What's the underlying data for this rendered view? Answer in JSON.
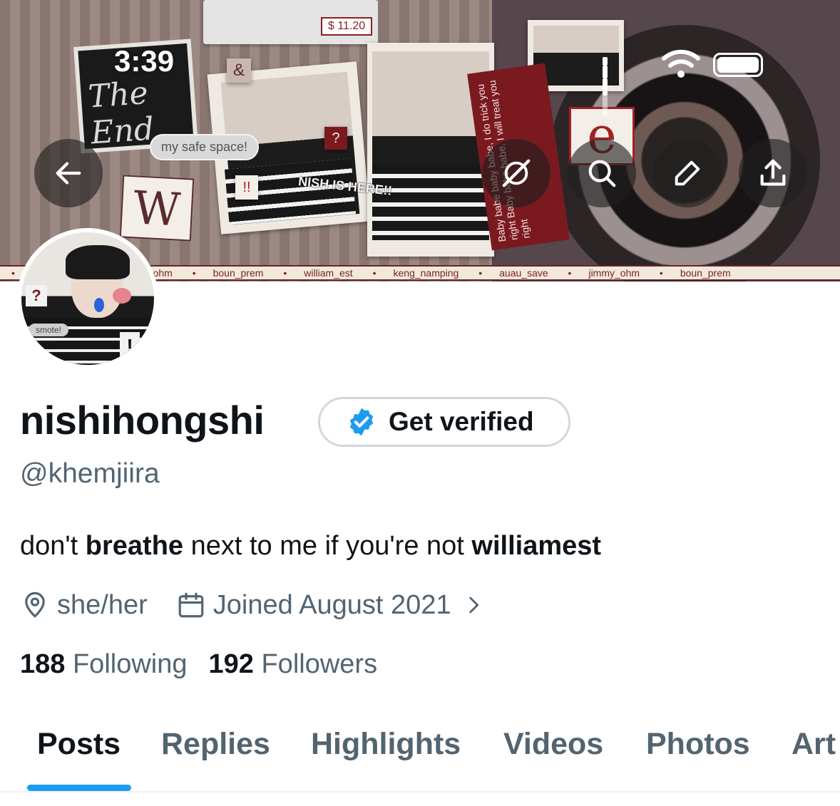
{
  "status_bar": {
    "time": "3:39"
  },
  "banner": {
    "the_end_text": "The End",
    "safe_space_text": "my safe space!",
    "price_text": "$ 11.20",
    "nish_text": "NISH IS HERE!!",
    "w_text": "W",
    "e_text": "e",
    "amp_text": "&",
    "q_text": "?",
    "excl_text": "!!",
    "lyrics_text": "Baby babe baby babe, I do trick you right Baby babe babe, I will treat you right",
    "ticker": [
      "auau_save",
      "jimmy_ohm",
      "boun_prem",
      "william_est",
      "keng_namping",
      "auau_save",
      "jimmy_ohm",
      "boun_prem"
    ]
  },
  "avatar": {
    "q_text": "?",
    "smote_text": "smote!",
    "excl_text": "!"
  },
  "header_buttons": {
    "back": "arrow-left-icon",
    "grok": "grok-icon",
    "search": "search-icon",
    "edit": "pencil-icon",
    "share": "share-icon"
  },
  "profile": {
    "display_name": "nishihongshi",
    "get_verified_label": "Get verified",
    "handle": "@khemjiira",
    "bio": {
      "part1": "don't ",
      "bold1": "breathe",
      "part2": " next to me if you're not ",
      "bold2": "williamest"
    },
    "pronouns": "she/her",
    "joined": "Joined August 2021",
    "following_count": "188",
    "following_label": "Following",
    "followers_count": "192",
    "followers_label": "Followers"
  },
  "tabs": [
    {
      "label": "Posts",
      "active": true
    },
    {
      "label": "Replies",
      "active": false
    },
    {
      "label": "Highlights",
      "active": false
    },
    {
      "label": "Videos",
      "active": false
    },
    {
      "label": "Photos",
      "active": false
    },
    {
      "label": "Art",
      "active": false
    }
  ],
  "colors": {
    "accent": "#1d9bf0",
    "text": "#0f1419",
    "secondary": "#536471",
    "border": "#cfd9de"
  }
}
